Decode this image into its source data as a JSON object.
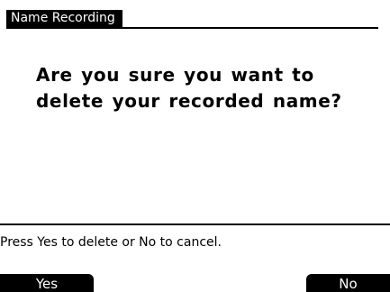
{
  "title": "Name Recording",
  "message": {
    "line1": "Are you sure you want to",
    "line2": "delete your recorded name?"
  },
  "hint": "Press Yes to delete or No to cancel.",
  "softkeys": {
    "left": "Yes",
    "right": "No"
  },
  "colors": {
    "background": "#ffffff",
    "foreground": "#000000"
  }
}
